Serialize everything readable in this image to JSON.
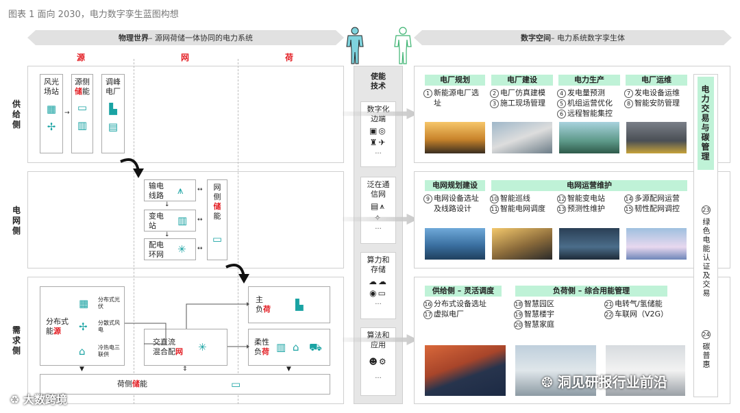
{
  "figure_title": "图表 1 面向 2030，电力数字孪生蓝图构想",
  "left_banner": {
    "bold": "物理世界",
    "rest": " – 源网荷储一体协同的电力系统"
  },
  "right_banner": {
    "bold": "数字空间",
    "rest": " – 电力系统数字孪生体"
  },
  "columns": {
    "source": "源",
    "grid": "网",
    "load": "荷"
  },
  "rows": {
    "supply": "供给侧",
    "grid": "电网侧",
    "demand": "需求侧"
  },
  "supply": {
    "wind_pv": "风光场站",
    "source_storage_a": "源侧",
    "source_storage_red": "储",
    "source_storage_b": "能",
    "peak_plant": "调峰电厂"
  },
  "grid": {
    "transmission": "输电线路",
    "substation": "变电站",
    "distribution": "配电环网",
    "grid_storage_a": "网侧",
    "grid_storage_red": "储",
    "grid_storage_b": "能"
  },
  "demand": {
    "distributed_a": "分布式",
    "distributed_b": "能",
    "distributed_red": "源",
    "pv": "分布式光伏",
    "wind": "分散式风电",
    "chp": "冷热电三联供",
    "hybrid_a": "交直流",
    "hybrid_b": "混合配",
    "hybrid_red": "网",
    "main_load_a": "主",
    "main_load_b": "负",
    "main_load_red": "荷",
    "flex_load_a": "柔性",
    "flex_load_b": "负",
    "flex_load_red": "荷",
    "load_storage_a": "荷侧",
    "load_storage_red": "储",
    "load_storage_b": "能"
  },
  "enablers": {
    "title": "使能技术",
    "cards": [
      {
        "label": "数字化边端",
        "dots": "..."
      },
      {
        "label": "泛在通信网",
        "dots": "..."
      },
      {
        "label": "算力和存储",
        "dots": "..."
      },
      {
        "label": "算法和应用",
        "dots": "..."
      }
    ]
  },
  "digital": {
    "supply_groups": [
      {
        "header": "电厂规划",
        "items": [
          {
            "n": "1",
            "t": "新能源电厂选"
          },
          {
            "n": "",
            "t": "址"
          }
        ]
      },
      {
        "header": "电厂建设",
        "items": [
          {
            "n": "2",
            "t": "电厂仿真建模"
          },
          {
            "n": "3",
            "t": "施工现场管理"
          }
        ]
      },
      {
        "header": "电力生产",
        "items": [
          {
            "n": "4",
            "t": "发电量预测"
          },
          {
            "n": "5",
            "t": "机组运营优化"
          },
          {
            "n": "6",
            "t": "远程智能集控"
          }
        ]
      },
      {
        "header": "电厂运维",
        "items": [
          {
            "n": "7",
            "t": "发电设备运维"
          },
          {
            "n": "8",
            "t": "智能安防管理"
          }
        ]
      }
    ],
    "grid_groups": [
      {
        "header": "电网规划建设",
        "items": [
          {
            "n": "9",
            "t": "电网设备选址"
          },
          {
            "n": "",
            "t": "及线路设计"
          }
        ]
      },
      {
        "header": "电网运营维护",
        "cols": [
          [
            {
              "n": "10",
              "t": "智能巡线"
            },
            {
              "n": "11",
              "t": "智能电网调度"
            }
          ],
          [
            {
              "n": "12",
              "t": "智能变电站"
            },
            {
              "n": "13",
              "t": "预测性维护"
            }
          ],
          [
            {
              "n": "14",
              "t": "多源配网运营"
            },
            {
              "n": "15",
              "t": "韧性配网调控"
            }
          ]
        ]
      }
    ],
    "demand_groups": [
      {
        "header": "供给侧 – 灵活调度",
        "items": [
          {
            "n": "16",
            "t": "分布式设备选址"
          },
          {
            "n": "17",
            "t": "虚拟电厂"
          }
        ]
      },
      {
        "header": "负荷侧 – 综合用能管理",
        "cols": [
          [
            {
              "n": "18",
              "t": "智慧园区"
            },
            {
              "n": "19",
              "t": "智慧楼宇"
            },
            {
              "n": "20",
              "t": "智慧家庭"
            }
          ],
          [
            {
              "n": "21",
              "t": "电转气/氢储能"
            },
            {
              "n": "22",
              "t": "车联网（V2G）"
            }
          ]
        ]
      }
    ],
    "carbon": {
      "title": "电力交易与碳管理",
      "n23": "23",
      "t23": "绿色电能认证及交易",
      "n24": "24",
      "t24": "碳普惠"
    }
  },
  "watermarks": {
    "left": "大数跨境",
    "right": "洞见研报行业前沿"
  },
  "colors": {
    "accent_red": "#e31e24",
    "green_header": "#bff2d7",
    "teal_icon": "#1aa3a3"
  }
}
